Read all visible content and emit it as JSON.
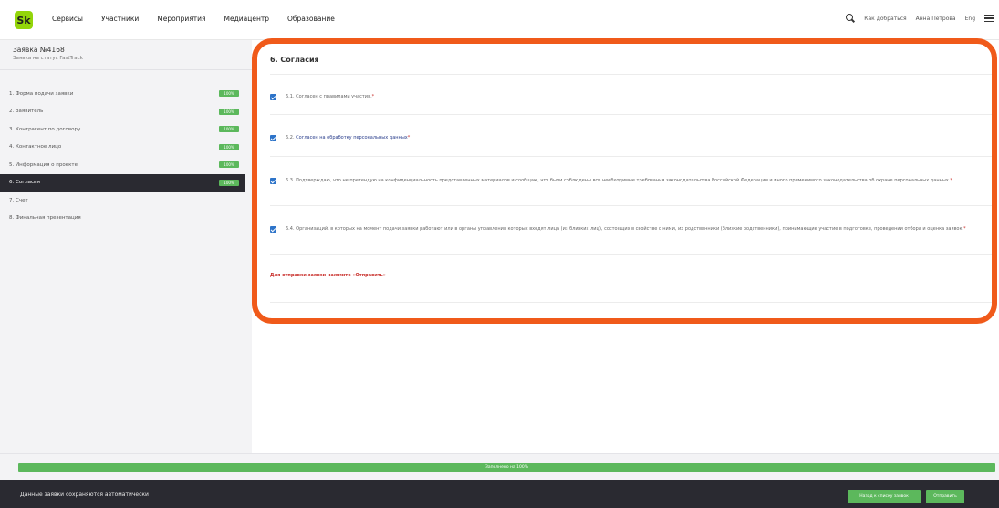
{
  "header": {
    "logo_text": "Sk",
    "nav": [
      "Сервисы",
      "Участники",
      "Мероприятия",
      "Медиацентр",
      "Образование"
    ],
    "how_to_get": "Как добраться",
    "user_name": "Анна Петрова",
    "lang": "Eng"
  },
  "sidebar": {
    "title": "Заявка №4168",
    "subtitle": "Заявка на статус FastTrack",
    "steps": [
      {
        "label": "1. Форма подачи заявки",
        "badge": "100%"
      },
      {
        "label": "2. Заявитель",
        "badge": "100%"
      },
      {
        "label": "3. Контрагент по договору",
        "badge": "100%"
      },
      {
        "label": "4. Контактное лицо",
        "badge": "100%"
      },
      {
        "label": "5. Информация о проекте",
        "badge": "100%"
      },
      {
        "label": "6. Согласия",
        "badge": "100%"
      },
      {
        "label": "7. Счет",
        "badge": ""
      },
      {
        "label": "8. Финальная презентация",
        "badge": ""
      }
    ]
  },
  "main": {
    "section_title": "6. Согласия",
    "consents": [
      {
        "prefix": "6.1. ",
        "text": "Согласен с правилами участия.",
        "link": ""
      },
      {
        "prefix": "6.2. ",
        "text": "",
        "link": "Согласен на обработку персональных данных"
      },
      {
        "prefix": "6.3. ",
        "text": "Подтверждаю, что не претендую на конфиденциальность представленных материалов и сообщаю, что были соблюдены все необходимые требования законодательства Российской Федерации и иного применимого законодательства об охране персональных данных.",
        "link": ""
      },
      {
        "prefix": "6.4. ",
        "text": "Организаций, в которых на момент подачи заявки работают или в органы управления которых входят лица (из близких лиц), состоящих в свойстве с ними, их родственники (близкие родственники), принимающие участие в подготовке, проведении отбора и оценка заявок.",
        "link": ""
      }
    ],
    "required_mark": "*",
    "submit_note": "Для отправки заявки нажмите «Отправить»"
  },
  "progress": {
    "label": "Заполнено на 100%",
    "value": 100
  },
  "footer": {
    "autosave_text": "Данные заявки сохраняются автоматически",
    "back_label": "Назад к списку заявок",
    "send_label": "Отправить"
  },
  "colors": {
    "accent": "#5cb85c",
    "highlight": "#f05a1a",
    "dark": "#2a2a31",
    "checkbox": "#2e74c9"
  }
}
